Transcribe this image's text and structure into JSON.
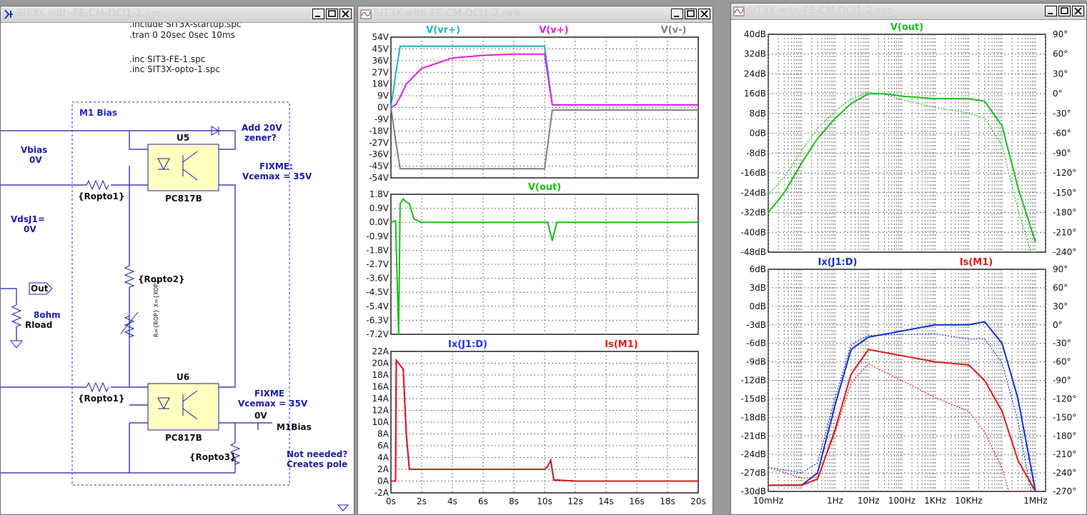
{
  "windows": {
    "schematic": {
      "title": "SIT3X-with-FE-CM-DCJ1-2.asc",
      "directives": [
        ".include SIT3X-startup.spc",
        ".tran 0 20sec 0sec 10ms",
        ".inc SIT3-FE-1.spc",
        ".inc SIT3X-opto-1.spc"
      ],
      "box_label": "M1 Bias",
      "note_zener": [
        "Add 20V",
        "zener?"
      ],
      "note_fixme1": [
        "FIXME:",
        "Vcemax = 35V"
      ],
      "note_fixme2": [
        "FIXME",
        "Vcemax = 35V"
      ],
      "note_pole": [
        "Not needed?",
        "Creates pole"
      ],
      "vbias": [
        "Vbias",
        "0V"
      ],
      "vdsj1": [
        "VdsJ1=",
        "0V"
      ],
      "u5": {
        "ref": "U5",
        "model": "PC817B"
      },
      "u6": {
        "ref": "U6",
        "model": "PC817B"
      },
      "r_opto1_a": "{Ropto1}",
      "r_opto1_b": "{Ropto1}",
      "r_opto2": "{Ropto2}",
      "r_opto3": "{Ropto3}",
      "pot_label": "R={ROP} X={XOP}",
      "out_label": "Out",
      "rload_value": "8ohm",
      "rload_name": "Rload",
      "m1bias_voltage": "0V",
      "m1bias_label": "M1Bias"
    },
    "transient": {
      "title": "SIT3X-with-FE-CM-DCJ1-2.raw",
      "xticks": [
        "0s",
        "2s",
        "4s",
        "6s",
        "8s",
        "10s",
        "12s",
        "14s",
        "16s",
        "18s",
        "20s"
      ],
      "pane1": {
        "traces": [
          {
            "name": "V(vr+)",
            "color": "#18b4c0"
          },
          {
            "name": "V(v+)",
            "color": "#e020e0"
          },
          {
            "name": "V(v-)",
            "color": "#808080"
          }
        ],
        "yticks": [
          "54V",
          "45V",
          "36V",
          "27V",
          "18V",
          "9V",
          "0V",
          "-9V",
          "-18V",
          "-27V",
          "-36V",
          "-45V",
          "-54V"
        ]
      },
      "pane2": {
        "traces": [
          {
            "name": "V(out)",
            "color": "#18c018"
          }
        ],
        "yticks": [
          "1.8V",
          "0.9V",
          "0.0V",
          "-0.9V",
          "-1.8V",
          "-2.7V",
          "-3.6V",
          "-4.5V",
          "-5.4V",
          "-6.3V",
          "-7.2V"
        ]
      },
      "pane3": {
        "traces": [
          {
            "name": "Ix(J1:D)",
            "color": "#2030ff"
          },
          {
            "name": "Is(M1)",
            "color": "#e01818"
          }
        ],
        "yticks": [
          "22A",
          "20A",
          "18A",
          "16A",
          "14A",
          "12A",
          "10A",
          "8A",
          "6A",
          "4A",
          "2A",
          "0A",
          "-2A"
        ]
      }
    },
    "ac": {
      "title": "SIT3X-with-FE-CM-DCJ1-2.asc",
      "xticks": [
        "10mHz",
        "1Hz",
        "10Hz",
        "100Hz",
        "1KHz",
        "10KHz",
        "1MHz"
      ],
      "pane1": {
        "traces": [
          {
            "name": "V(out)",
            "color": "#18c018"
          }
        ],
        "yticks_left": [
          "40dB",
          "32dB",
          "24dB",
          "16dB",
          "8dB",
          "0dB",
          "-8dB",
          "-16dB",
          "-24dB",
          "-32dB",
          "-40dB",
          "-48dB"
        ],
        "yticks_right": [
          "90°",
          "60°",
          "30°",
          "0°",
          "-30°",
          "-60°",
          "-90°",
          "-120°",
          "-150°",
          "-180°",
          "-210°",
          "-240°"
        ]
      },
      "pane2": {
        "traces": [
          {
            "name": "Ix(J1:D)",
            "color": "#1030d0"
          },
          {
            "name": "Is(M1)",
            "color": "#e01818"
          }
        ],
        "yticks_left": [
          "6dB",
          "3dB",
          "0dB",
          "-3dB",
          "-6dB",
          "-9dB",
          "-12dB",
          "-15dB",
          "-18dB",
          "-21dB",
          "-24dB",
          "-27dB",
          "-30dB"
        ],
        "yticks_right": [
          "90°",
          "60°",
          "30°",
          "0°",
          "-30°",
          "-60°",
          "-90°",
          "-120°",
          "-150°",
          "-180°",
          "-210°",
          "-240°",
          "-270°"
        ]
      }
    }
  },
  "chart_data": [
    {
      "type": "line",
      "x": [
        0,
        0.3,
        0.6,
        1,
        2,
        4,
        6,
        8,
        10,
        10.5,
        12,
        16,
        20
      ],
      "series": [
        {
          "name": "V(vr+)",
          "values": [
            0,
            25,
            47,
            47,
            47,
            47,
            47,
            47,
            47,
            2,
            2,
            2,
            2
          ]
        },
        {
          "name": "V(v+)",
          "values": [
            0,
            2,
            8,
            18,
            30,
            38,
            40,
            41,
            41,
            2,
            2,
            2,
            2
          ]
        },
        {
          "name": "V(v-)",
          "values": [
            0,
            -25,
            -47,
            -47,
            -47,
            -47,
            -47,
            -47,
            -47,
            -2,
            -2,
            -2,
            -2
          ]
        }
      ],
      "ylim": [
        -54,
        54
      ],
      "xlim": [
        0,
        20
      ],
      "grid": true
    },
    {
      "type": "line",
      "x": [
        0,
        0.3,
        0.5,
        0.6,
        0.8,
        1.0,
        1.2,
        1.5,
        2,
        4,
        10,
        10.2,
        10.5,
        10.8,
        11,
        12,
        20
      ],
      "series": [
        {
          "name": "V(out)",
          "values": [
            0,
            0.1,
            -7.2,
            1.2,
            1.5,
            1.3,
            1.2,
            0.2,
            0,
            0,
            0,
            0,
            -1.2,
            0,
            0,
            0,
            0
          ]
        }
      ],
      "ylim": [
        -7.2,
        1.8
      ],
      "xlim": [
        0,
        20
      ],
      "grid": true
    },
    {
      "type": "line",
      "x": [
        0,
        0.3,
        0.35,
        0.5,
        0.8,
        1.0,
        1.2,
        1.5,
        2,
        6,
        10,
        10.2,
        10.4,
        10.6,
        12,
        20
      ],
      "series": [
        {
          "name": "Ix(J1:D)",
          "values": [
            0,
            0,
            20.5,
            20,
            19,
            8,
            2,
            2,
            2,
            2,
            2,
            2.5,
            3.5,
            0.2,
            0,
            0
          ]
        },
        {
          "name": "Is(M1)",
          "values": [
            0,
            0,
            20.5,
            20,
            19,
            8,
            2,
            2,
            2,
            2,
            2,
            2.5,
            3.5,
            0.2,
            0,
            0
          ]
        }
      ],
      "ylim": [
        -2,
        22
      ],
      "xlim": [
        0,
        20
      ],
      "grid": true
    },
    {
      "type": "line",
      "x": [
        0.01,
        0.03,
        0.1,
        0.3,
        1,
        3,
        10,
        30,
        100,
        1000,
        10000,
        30000,
        100000,
        300000,
        1000000
      ],
      "series": [
        {
          "name": "V(out)",
          "values": [
            -32,
            -24,
            -12,
            -2,
            6,
            12,
            16,
            16,
            15,
            14,
            14,
            13,
            3,
            -22,
            -44
          ]
        }
      ],
      "ylim": [
        -48,
        40
      ],
      "xlim": [
        0.01,
        2000000
      ],
      "xscale": "log",
      "grid": true
    },
    {
      "type": "line",
      "x": [
        0.01,
        0.1,
        0.3,
        1,
        3,
        10,
        100,
        1000,
        10000,
        30000,
        100000,
        300000,
        1000000
      ],
      "series": [
        {
          "name": "Ix(J1:D)",
          "values": [
            -29,
            -29,
            -27,
            -16,
            -7,
            -5,
            -4,
            -3,
            -3,
            -2.5,
            -6,
            -15,
            -30
          ]
        },
        {
          "name": "Is(M1)",
          "values": [
            -29,
            -29,
            -28,
            -20,
            -11,
            -7,
            -8,
            -9,
            -9.5,
            -12,
            -17,
            -25,
            -30
          ]
        }
      ],
      "ylim": [
        -30,
        6
      ],
      "xlim": [
        0.01,
        2000000
      ],
      "xscale": "log",
      "grid": true
    }
  ]
}
